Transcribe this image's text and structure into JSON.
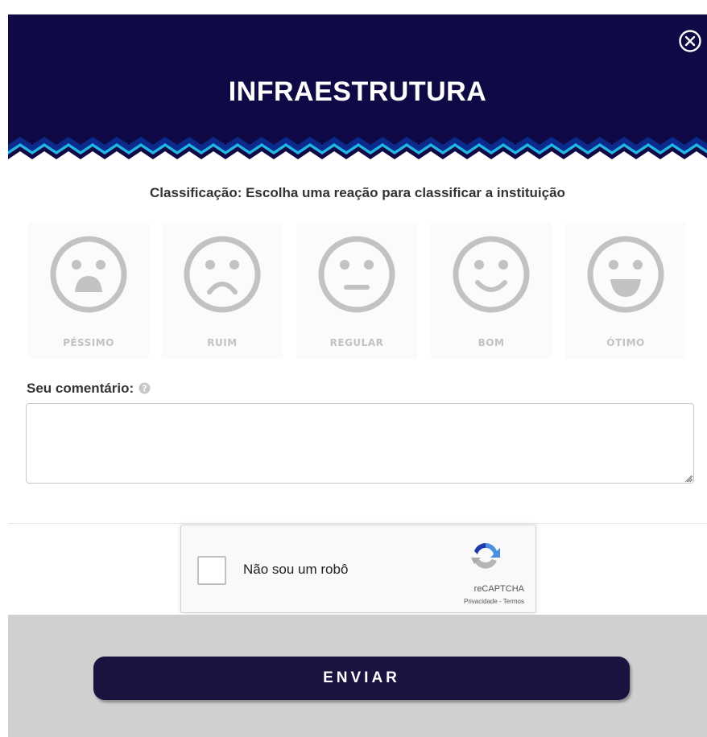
{
  "header": {
    "title": "INFRAESTRUTURA",
    "close_icon": "close-circle-icon",
    "colors": {
      "background": "#0f0a45",
      "zigzag_light": "#1fb6e8",
      "zigzag_dark": "#0a2a8c"
    }
  },
  "rating": {
    "prompt": "Classificação: Escolha uma reação para classificar a instituição",
    "options": [
      {
        "label": "PÉSSIMO",
        "icon": "very-sad-face-icon"
      },
      {
        "label": "RUIM",
        "icon": "sad-face-icon"
      },
      {
        "label": "REGULAR",
        "icon": "neutral-face-icon"
      },
      {
        "label": "BOM",
        "icon": "smile-face-icon"
      },
      {
        "label": "ÓTIMO",
        "icon": "laughing-face-icon"
      }
    ]
  },
  "comment": {
    "label": "Seu comentário:",
    "help_icon": "question-circle-icon",
    "value": "",
    "placeholder": ""
  },
  "recaptcha": {
    "label": "Não sou um robô",
    "brand": "reCAPTCHA",
    "privacy": "Privacidade",
    "separator": " - ",
    "terms": "Termos"
  },
  "footer": {
    "submit_label": "ENVIAR",
    "colors": {
      "button": "#1b1240",
      "background": "#d0d0d0"
    }
  }
}
